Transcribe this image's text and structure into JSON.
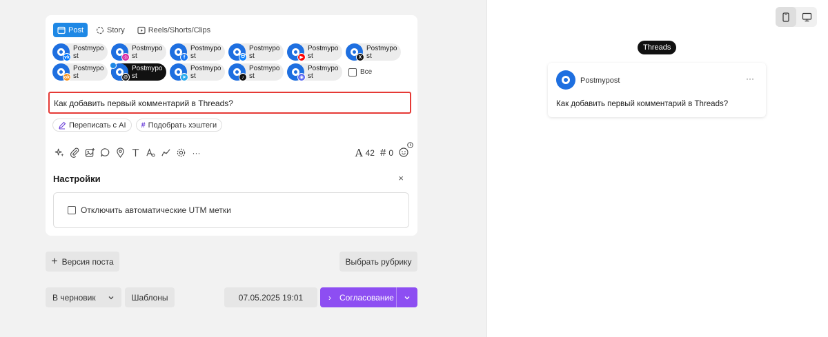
{
  "composer": {
    "tabs": [
      {
        "label": "Post",
        "icon": "post-icon",
        "active": true
      },
      {
        "label": "Story",
        "icon": "story-icon",
        "active": false
      },
      {
        "label": "Reels/Shorts/Clips",
        "icon": "reels-icon",
        "active": false
      }
    ],
    "accounts_row1": [
      {
        "name": "Postmypost",
        "network": "vk",
        "color": "#0077ff",
        "glyph": "vk"
      },
      {
        "name": "Postmypost",
        "network": "instagram",
        "color": "#d6249f",
        "glyph": "◎"
      },
      {
        "name": "Postmypost",
        "network": "facebook",
        "color": "#1877f2",
        "glyph": "f"
      },
      {
        "name": "Postmypost",
        "network": "bluesky",
        "color": "#1185fe",
        "glyph": "ᗢ"
      },
      {
        "name": "Postmypost",
        "network": "youtube",
        "color": "#ff0000",
        "glyph": "▶"
      },
      {
        "name": "Postmypost",
        "network": "x",
        "color": "#111111",
        "glyph": "X"
      }
    ],
    "accounts_row2": [
      {
        "name": "Postmypost",
        "network": "ok",
        "color": "#f7931e",
        "glyph": "ok"
      },
      {
        "name": "Postmypost",
        "network": "threads",
        "color": "#111111",
        "glyph": "@",
        "selected": true
      },
      {
        "name": "Postmypost",
        "network": "telegram",
        "color": "#2aabee",
        "glyph": "➤"
      },
      {
        "name": "Postmypost",
        "network": "tiktok",
        "color": "#111111",
        "glyph": "♪"
      },
      {
        "name": "Postmypost",
        "network": "discord",
        "color": "#5865f2",
        "glyph": "◉"
      }
    ],
    "select_all_label": "Все",
    "post_text": "Как добавить первый комментарий в Threads?",
    "rewrite_ai_label": "Переписать с AI",
    "hashtags_label": "Подобрать хэштеги",
    "char_count": "42",
    "hashtag_count": "0"
  },
  "settings": {
    "title": "Настройки",
    "close_glyph": "×",
    "utm_label": "Отключить автоматические UTM метки"
  },
  "bottom": {
    "post_version_label": "Версия поста",
    "choose_rubric_label": "Выбрать рубрику",
    "draft_label": "В черновик",
    "templates_label": "Шаблоны",
    "datetime": "07.05.2025 19:01",
    "approval_label": "Согласование"
  },
  "preview": {
    "network_badge": "Threads",
    "account_name": "Postmypost",
    "more_glyph": "···",
    "text": "Как добавить первый комментарий в Threads?"
  },
  "colors": {
    "accent_blue": "#1e88e5",
    "primary_purple": "#8d4ef2",
    "highlight_red": "#e53935"
  }
}
